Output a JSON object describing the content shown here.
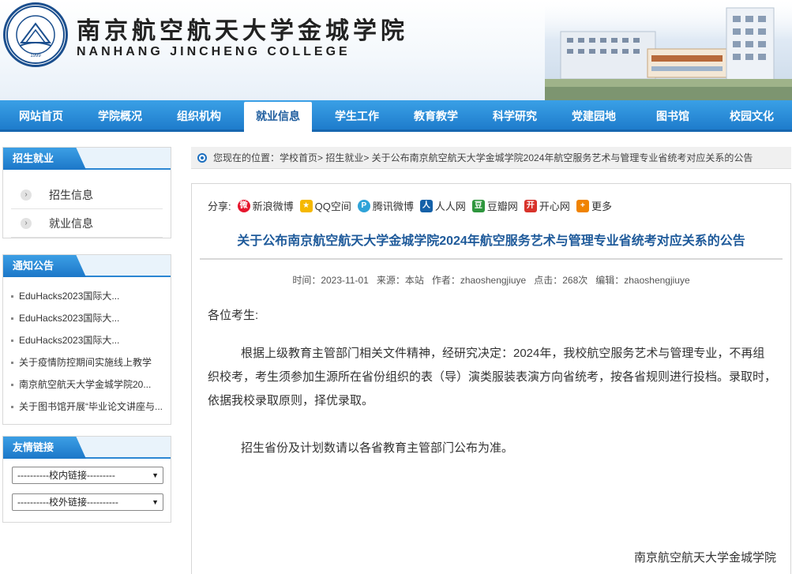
{
  "header": {
    "site_name_cn": "南京航空航天大学金城学院",
    "site_name_en": "NANHANG JINCHENG COLLEGE",
    "logo_year": "1999"
  },
  "nav": {
    "items": [
      {
        "label": "网站首页"
      },
      {
        "label": "学院概况"
      },
      {
        "label": "组织机构"
      },
      {
        "label": "就业信息"
      },
      {
        "label": "学生工作"
      },
      {
        "label": "教育教学"
      },
      {
        "label": "科学研究"
      },
      {
        "label": "党建园地"
      },
      {
        "label": "图书馆"
      },
      {
        "label": "校园文化"
      }
    ],
    "active": "就业信息"
  },
  "sidebar": {
    "admission": {
      "title": "招生就业",
      "items": [
        {
          "label": "招生信息"
        },
        {
          "label": "就业信息"
        }
      ]
    },
    "notices": {
      "title": "通知公告",
      "items": [
        {
          "label": "EduHacks2023国际大..."
        },
        {
          "label": "EduHacks2023国际大..."
        },
        {
          "label": "EduHacks2023国际大..."
        },
        {
          "label": "关于疫情防控期间实施线上教学"
        },
        {
          "label": "南京航空航天大学金城学院20..."
        },
        {
          "label": "关于图书馆开展“毕业论文讲座与..."
        }
      ]
    },
    "links": {
      "title": "友情链接",
      "internal": "----------校内链接---------",
      "external": "----------校外链接----------"
    }
  },
  "breadcrumb": {
    "text": "您现在的位置：学校首页> 招生就业> 关于公布南京航空航天大学金城学院2024年航空服务艺术与管理专业省统考对应关系的公告"
  },
  "article": {
    "share_label": "分享:",
    "share_items": [
      {
        "label": "新浪微博",
        "color": "#e6162d",
        "icon": "weibo-icon"
      },
      {
        "label": "QQ空间",
        "color": "#f5b800",
        "icon": "qzone-icon"
      },
      {
        "label": "腾讯微博",
        "color": "#2fa3d8",
        "icon": "tencent-weibo-icon"
      },
      {
        "label": "人人网",
        "color": "#1561a8",
        "icon": "renren-icon"
      },
      {
        "label": "豆瓣网",
        "color": "#2e963d",
        "icon": "douban-icon"
      },
      {
        "label": "开心网",
        "color": "#d8332b",
        "icon": "kaixin-icon"
      },
      {
        "label": "更多",
        "color": "#f08300",
        "icon": "plus-icon"
      }
    ],
    "title": "关于公布南京航空航天大学金城学院2024年航空服务艺术与管理专业省统考对应关系的公告",
    "meta": "时间：2023-11-01   来源：本站   作者：zhaoshengjiuye   点击：268次   编辑：zhaoshengjiuye",
    "greeting": "各位考生:",
    "p1": "根据上级教育主管部门相关文件精神，经研究决定：2024年，我校航空服务艺术与管理专业，不再组织校考，考生须参加生源所在省份组织的表（导）演类服装表演方向省统考，按各省规则进行投档。录取时，依据我校录取原则，择优录取。",
    "p2": "招生省份及计划数请以各省教育主管部门公布为准。",
    "signature": "南京航空航天大学金城学院"
  },
  "colors": {
    "nav_bg": "#1e7ccc",
    "title_blue": "#1e5a9a",
    "accent": "#2b86d3"
  }
}
